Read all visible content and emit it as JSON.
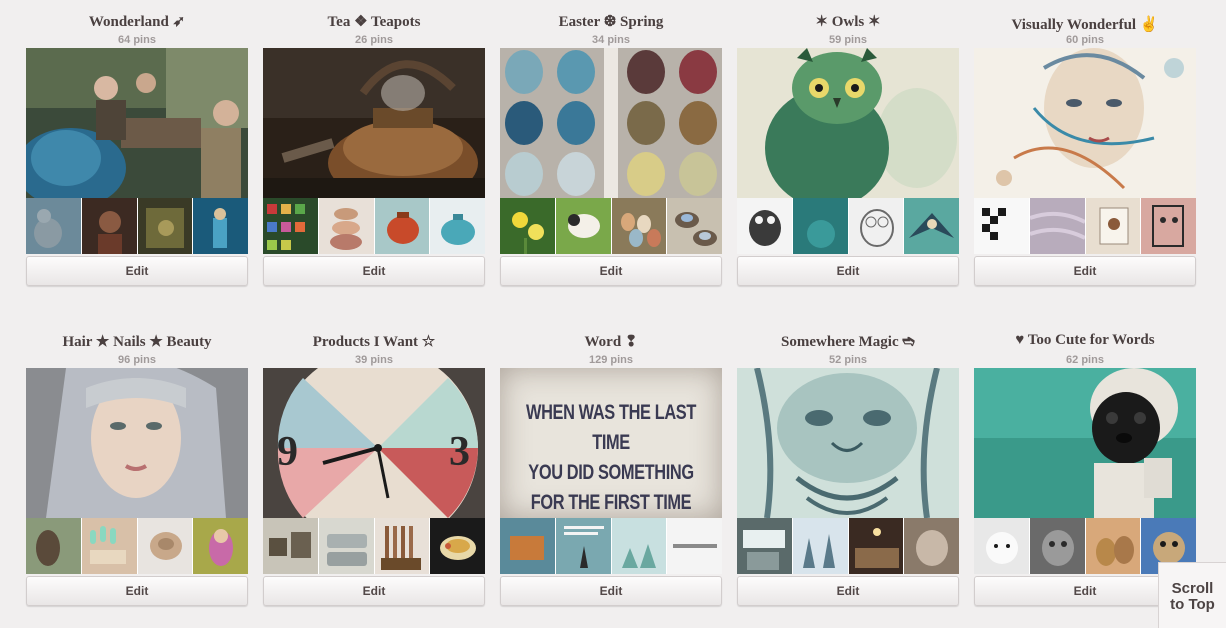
{
  "boards": [
    {
      "title": "Wonderland ➶",
      "count": "64 pins",
      "edit_label": "Edit"
    },
    {
      "title": "Tea ❖ Teapots",
      "count": "26 pins",
      "edit_label": "Edit"
    },
    {
      "title": "Easter ❆ Spring",
      "count": "34 pins",
      "edit_label": "Edit"
    },
    {
      "title": "✶ Owls ✶",
      "count": "59 pins",
      "edit_label": "Edit"
    },
    {
      "title": "Visually Wonderful ✌",
      "count": "60 pins",
      "edit_label": "Edit"
    },
    {
      "title": "Hair ★ Nails ★ Beauty",
      "count": "96 pins",
      "edit_label": "Edit"
    },
    {
      "title": "Products I Want ☆",
      "count": "39 pins",
      "edit_label": "Edit"
    },
    {
      "title": "Word ❢",
      "count": "129 pins",
      "edit_label": "Edit"
    },
    {
      "title": "Somewhere Magic ➬",
      "count": "52 pins",
      "edit_label": "Edit"
    },
    {
      "title": "♥ Too Cute for Words",
      "count": "62 pins",
      "edit_label": "Edit"
    }
  ],
  "word_cover_text": [
    "WHEN WAS THE LAST TIME",
    "YOU DID SOMETHING",
    "FOR THE FIRST TIME ?"
  ],
  "scroll_top": {
    "line1": "Scroll",
    "line2": "to Top"
  }
}
